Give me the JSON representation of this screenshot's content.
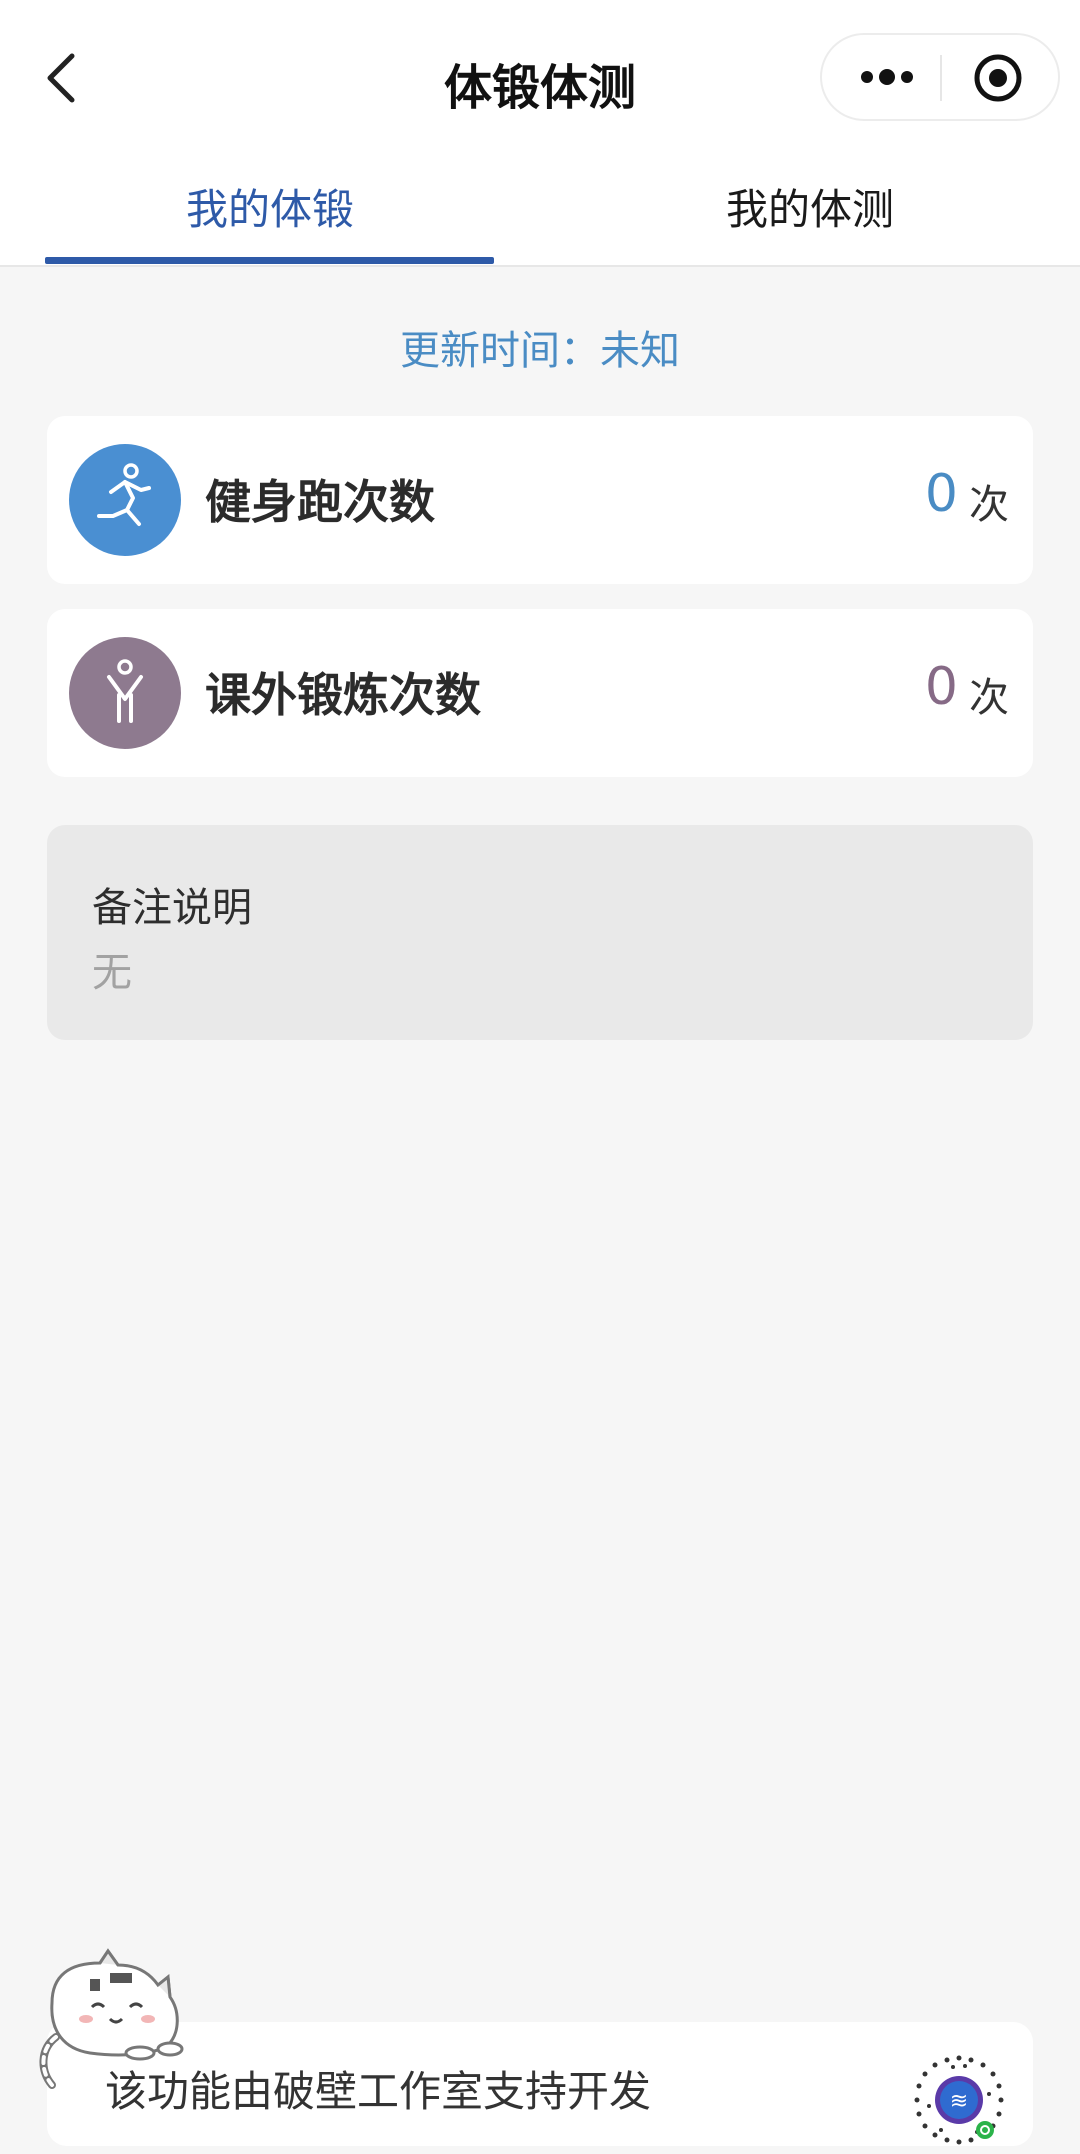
{
  "navbar": {
    "title": "体锻体测",
    "icons": {
      "back": "chevron-left-icon",
      "more": "more-dots-icon",
      "close": "circle-target-icon"
    }
  },
  "tabs": [
    {
      "label": "我的体锻",
      "active": true
    },
    {
      "label": "我的体测",
      "active": false
    }
  ],
  "colors": {
    "accent": "#2e5aa8",
    "update_text": "#4a8cc4",
    "run_icon_bg": "#4a8fd2",
    "run_value": "#4a8cc4",
    "extra_icon_bg": "#8e7a8f",
    "extra_value": "#866a86"
  },
  "update_time": "更新时间：未知",
  "cards": [
    {
      "label": "健身跑次数",
      "value": "0",
      "unit": "次",
      "icon": "running-person-icon"
    },
    {
      "label": "课外锻炼次数",
      "value": "0",
      "unit": "次",
      "icon": "stretching-person-icon"
    }
  ],
  "notes": {
    "title": "备注说明",
    "content": "无"
  },
  "footer": {
    "text": "该功能由破壁工作室支持开发",
    "icons": {
      "mascot": "cat-mascot-icon",
      "code": "mini-program-code-icon"
    }
  }
}
